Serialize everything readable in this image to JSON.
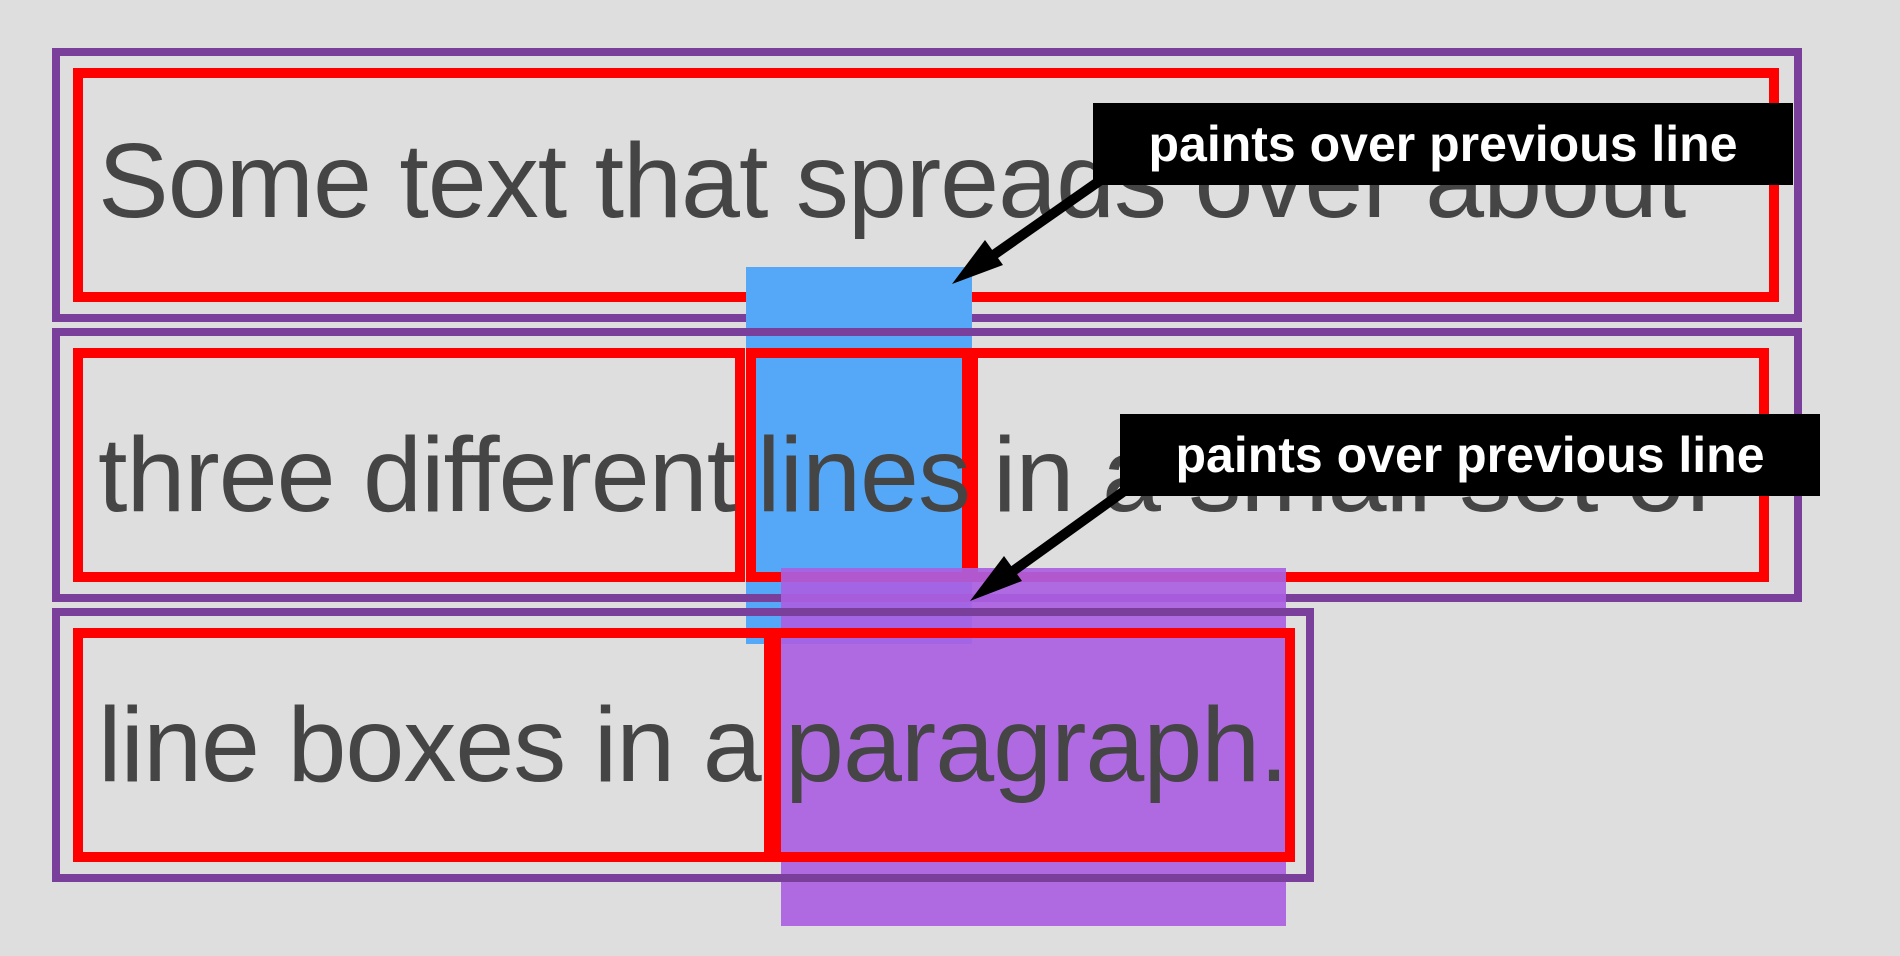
{
  "lines": [
    {
      "text": "Some text that spreads over about"
    },
    {
      "segment_1": "three different",
      "segment_2": "lines",
      "segment_3": "in a small set of"
    },
    {
      "segment_1": "line boxes in a",
      "segment_2": "paragraph."
    }
  ],
  "callouts": [
    {
      "label": "paints over previous line"
    },
    {
      "label": "paints over previous line"
    }
  ],
  "colors": {
    "background": "#dedede",
    "line_box_border": "#7a3f9a",
    "inline_box_border": "#ff0000",
    "highlight_blue": "#55a8f8",
    "highlight_purple": "#b068e3",
    "text": "#454545",
    "callout_bg": "#000000",
    "callout_text": "#ffffff"
  }
}
